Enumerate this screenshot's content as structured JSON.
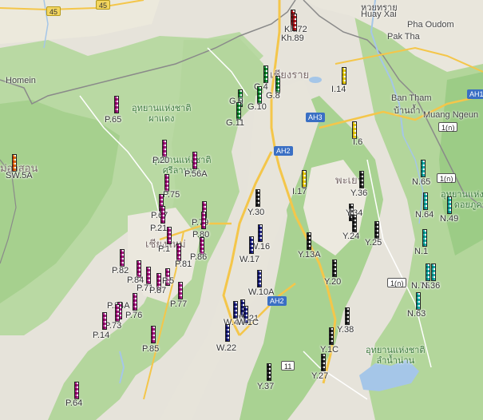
{
  "map": {
    "province_labels": [
      "เชียงราย",
      "พะเยา",
      "ม่องสอน",
      "เชียงใหม่"
    ],
    "place_labels": [
      "หวยทราย",
      "Huay Xai",
      "Pha Oudom",
      "Pak Tha",
      "Ban Tham",
      "บ้านถ้ำ",
      "Muang Ngeun",
      "Homein"
    ],
    "park_labels": {
      "p1": "อุทยานแห่งชาติ\nผาแดง",
      "p2": "อุทยานแห่งชาติ\nศรีลานนา",
      "p3": "อุทยานแห่งชาติ\nแม่ยม",
      "p4": "อุทยานแห่งชาติ\nดอยภูคา",
      "p5": "อุทยานแห่งชาติ\nลำน้ำน่าน"
    },
    "road_shields": [
      "AH3",
      "AH2",
      "AH2",
      "AH13",
      "1(ก)",
      "1(ก)",
      "1(ก)",
      "11",
      "45",
      "45"
    ]
  },
  "colors": {
    "red": "#b8232a",
    "green": "#1f9a45",
    "yellow": "#e6d21a",
    "magenta": "#b0228f",
    "navy": "#2b2f8f",
    "cyan": "#1fb5b0",
    "black": "#333333",
    "orange": "#e07b1b"
  },
  "markers": [
    {
      "label": "Kh.72",
      "color": "red"
    },
    {
      "label": "Kh.89",
      "color": "red"
    },
    {
      "label": "G.4",
      "color": "green"
    },
    {
      "label": "G.8",
      "color": "green"
    },
    {
      "label": "G.9",
      "color": "green"
    },
    {
      "label": "G.10",
      "color": "green"
    },
    {
      "label": "G.11",
      "color": "green"
    },
    {
      "label": "I.14",
      "color": "yellow"
    },
    {
      "label": "I.6",
      "color": "yellow"
    },
    {
      "label": "I.17",
      "color": "yellow"
    },
    {
      "label": "P.65",
      "color": "magenta"
    },
    {
      "label": "P.20",
      "color": "magenta"
    },
    {
      "label": "P.56A",
      "color": "magenta"
    },
    {
      "label": "P.75",
      "color": "magenta"
    },
    {
      "label": "P.67",
      "color": "magenta"
    },
    {
      "label": "P.21",
      "color": "magenta"
    },
    {
      "label": "P.79",
      "color": "magenta"
    },
    {
      "label": "P.80",
      "color": "magenta"
    },
    {
      "label": "P.1",
      "color": "magenta"
    },
    {
      "label": "P.86",
      "color": "magenta"
    },
    {
      "label": "P.81",
      "color": "magenta"
    },
    {
      "label": "P.82",
      "color": "magenta"
    },
    {
      "label": "P.84",
      "color": "magenta"
    },
    {
      "label": "P.5",
      "color": "magenta"
    },
    {
      "label": "P.71",
      "color": "magenta"
    },
    {
      "label": "P.87",
      "color": "magenta"
    },
    {
      "label": "P.77",
      "color": "magenta"
    },
    {
      "label": "P.24A",
      "color": "magenta"
    },
    {
      "label": "P.76",
      "color": "magenta"
    },
    {
      "label": "P.73",
      "color": "magenta"
    },
    {
      "label": "P.14",
      "color": "magenta"
    },
    {
      "label": "P.85",
      "color": "magenta"
    },
    {
      "label": "P.64",
      "color": "magenta"
    },
    {
      "label": "SW.5A",
      "color": "orange"
    },
    {
      "label": "Y.30",
      "color": "black"
    },
    {
      "label": "Y.36",
      "color": "black"
    },
    {
      "label": "Y.34",
      "color": "black"
    },
    {
      "label": "Y.24",
      "color": "black"
    },
    {
      "label": "Y.25",
      "color": "black"
    },
    {
      "label": "Y.13A",
      "color": "black"
    },
    {
      "label": "Y.20",
      "color": "black"
    },
    {
      "label": "Y.38",
      "color": "black"
    },
    {
      "label": "Y.1C",
      "color": "black"
    },
    {
      "label": "Y.27",
      "color": "black"
    },
    {
      "label": "Y.37",
      "color": "black"
    },
    {
      "label": "W.16",
      "color": "navy"
    },
    {
      "label": "W.17",
      "color": "navy"
    },
    {
      "label": "W.10A",
      "color": "navy"
    },
    {
      "label": "W.21",
      "color": "navy"
    },
    {
      "label": "W.4A",
      "color": "navy"
    },
    {
      "label": "W.1C",
      "color": "navy"
    },
    {
      "label": "W.22",
      "color": "navy"
    },
    {
      "label": "N.65",
      "color": "cyan"
    },
    {
      "label": "N.64",
      "color": "cyan"
    },
    {
      "label": "N.49",
      "color": "cyan"
    },
    {
      "label": "N.1",
      "color": "cyan"
    },
    {
      "label": "N.75",
      "color": "cyan"
    },
    {
      "label": "N.36",
      "color": "cyan"
    },
    {
      "label": "N.63",
      "color": "cyan"
    }
  ]
}
